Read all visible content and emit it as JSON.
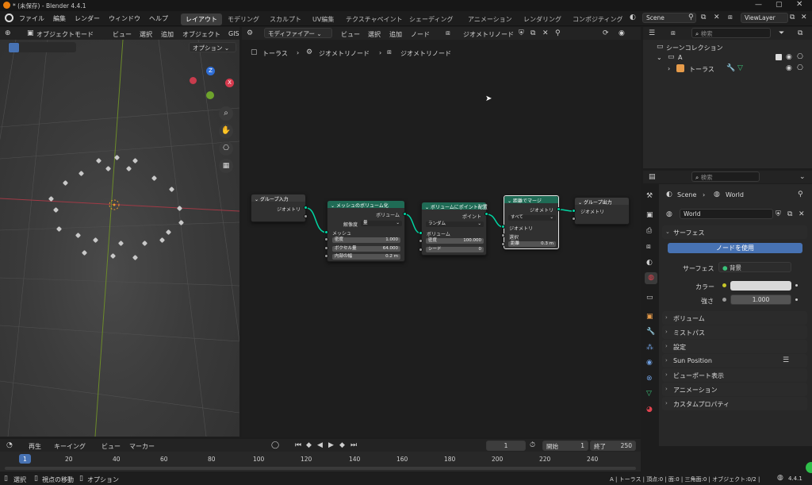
{
  "window": {
    "title": "* (未保存) - Blender 4.4.1"
  },
  "topmenu": [
    "ファイル",
    "編集",
    "レンダー",
    "ウィンドウ",
    "ヘルプ"
  ],
  "workspaces": [
    {
      "label": "レイアウト",
      "active": true
    },
    {
      "label": "モデリング"
    },
    {
      "label": "スカルプト"
    },
    {
      "label": "UV編集"
    },
    {
      "label": "テクスチャペイント"
    },
    {
      "label": "シェーディング"
    },
    {
      "label": "アニメーション"
    },
    {
      "label": "レンダリング"
    },
    {
      "label": "コンポジティング"
    }
  ],
  "scene": "Scene",
  "viewlayer": "ViewLayer",
  "viewport": {
    "mode": "オブジェクトモード",
    "menus": [
      "ビュー",
      "選択",
      "追加",
      "オブジェクト",
      "GIS"
    ],
    "options": "オプション"
  },
  "nodeeditor": {
    "type": "モディファイアー",
    "menus": [
      "ビュー",
      "選択",
      "追加",
      "ノード"
    ],
    "tree_name": "ジオメトリノード",
    "breadcrumb": [
      "トーラス",
      "ジオメトリノード",
      "ジオメトリノード"
    ]
  },
  "nodes": {
    "group_input": {
      "title": "グループ入力",
      "out": "ジオメトリ"
    },
    "mesh_to_volume": {
      "title": "メッシュのボリューム化",
      "out": "ボリューム",
      "resolution_label": "解像度",
      "resolution": "量",
      "in_mesh": "メッシュ",
      "density_label": "密度",
      "density": "1.000",
      "voxel_label": "ボクセル量",
      "voxel": "64.000",
      "interior_label": "内部の幅",
      "interior": "0.2 m"
    },
    "distribute": {
      "title": "ボリュームにポイント配置",
      "out": "ポイント",
      "mode": "ランダム",
      "in_volume": "ボリューム",
      "density_label": "密度",
      "density": "100.000",
      "seed_label": "シード",
      "seed": "0"
    },
    "merge": {
      "title": "距離でマージ",
      "out": "ジオメトリ",
      "mode": "すべて",
      "in_geometry": "ジオメトリ",
      "in_select": "選択",
      "dist_label": "距離",
      "dist": "0.3 m"
    },
    "group_output": {
      "title": "グループ出力",
      "in": "ジオメトリ"
    }
  },
  "outliner": {
    "search_placeholder": "検索",
    "collection": "シーンコレクション",
    "items": [
      {
        "label": "A"
      },
      {
        "label": "トーラス"
      }
    ]
  },
  "properties": {
    "search_placeholder": "検索",
    "breadcrumb": [
      "Scene",
      "World"
    ],
    "world_name": "World",
    "surface_header": "サーフェス",
    "use_nodes": "ノードを使用",
    "surface_label": "サーフェス",
    "surface_value": "背景",
    "color_label": "カラー",
    "strength_label": "強さ",
    "strength": "1.000",
    "panels": [
      "ボリューム",
      "ミストパス",
      "設定",
      "Sun Position",
      "ビューポート表示",
      "アニメーション",
      "カスタムプロパティ"
    ]
  },
  "timeline": {
    "menus": [
      "再生",
      "キーイング",
      "ビュー",
      "マーカー"
    ],
    "current_frame": "1",
    "start_label": "開始",
    "start": "1",
    "end_label": "終了",
    "end": "250",
    "ticks": [
      "1",
      "20",
      "40",
      "60",
      "80",
      "100",
      "120",
      "140",
      "160",
      "180",
      "200",
      "220",
      "240"
    ]
  },
  "statusbar": {
    "left": [
      "選択",
      "視点の移動",
      "オプション"
    ],
    "right": "A | トーラス | 頂点:0 | 面:0 | 三角面:0 | オブジェクト:0/2 | ",
    "version": "4.4.1"
  }
}
